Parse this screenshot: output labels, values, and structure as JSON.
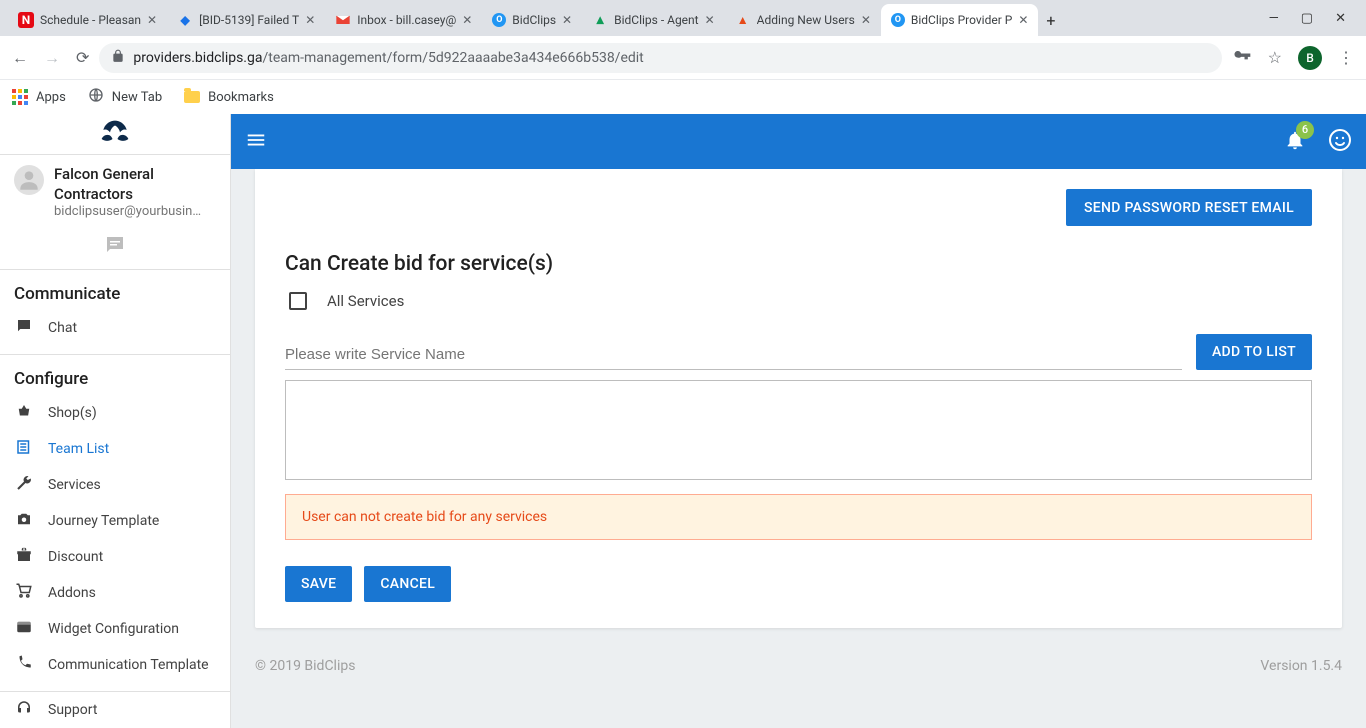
{
  "browser": {
    "tabs": [
      {
        "title": "Schedule - Pleasan",
        "fav": "N"
      },
      {
        "title": "[BID-5139] Failed T",
        "fav": "◆"
      },
      {
        "title": "Inbox - bill.casey@",
        "fav": "M"
      },
      {
        "title": "BidClips",
        "fav": "O"
      },
      {
        "title": "BidClips - Agent",
        "fav": "▲"
      },
      {
        "title": "Adding New Users",
        "fav": "▲"
      },
      {
        "title": "BidClips Provider P",
        "fav": "O",
        "active": true
      }
    ],
    "url_host": "providers.bidclips.ga",
    "url_path": "/team-management/form/5d922aaaabe3a434e666b538/edit",
    "avatar_letter": "B",
    "bookmarks": {
      "apps": "Apps",
      "newtab": "New Tab",
      "bookmarks": "Bookmarks"
    }
  },
  "sidebar": {
    "company": "Falcon General Contractors",
    "email": "bidclipsuser@yourbusin…",
    "sections": {
      "communicate": "Communicate",
      "configure": "Configure"
    },
    "items": {
      "chat": "Chat",
      "shops": "Shop(s)",
      "team": "Team List",
      "services": "Services",
      "journey": "Journey Template",
      "discount": "Discount",
      "addons": "Addons",
      "widget": "Widget Configuration",
      "comm_tpl": "Communication Template",
      "support": "Support"
    }
  },
  "topbar": {
    "notif_count": "6"
  },
  "form": {
    "pw_button": "SEND PASSWORD RESET EMAIL",
    "section_title": "Can Create bid for service(s)",
    "checkbox_all": "All Services",
    "service_placeholder": "Please write Service Name",
    "add_to_list": "ADD TO LIST",
    "warning": "User can not create bid for any services",
    "save": "SAVE",
    "cancel": "CANCEL"
  },
  "footer": {
    "copyright": "© 2019 BidClips",
    "version": "Version 1.5.4"
  }
}
